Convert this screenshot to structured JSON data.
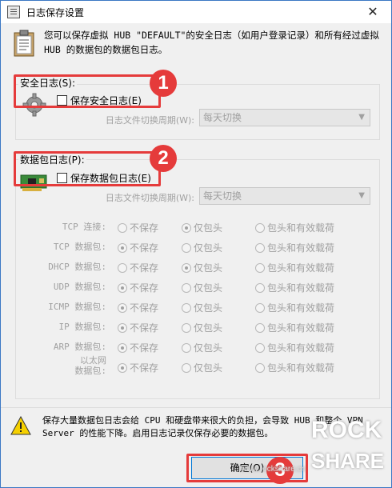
{
  "window": {
    "title": "日志保存设置",
    "close": "✕"
  },
  "intro": "您可以保存虚拟 HUB \"DEFAULT\"的安全日志（如用户登录记录）和所有经过虚拟 HUB 的数据包的数据包日志。",
  "security": {
    "group_label": "安全日志(S):",
    "checkbox_label": "保存安全日志(E)",
    "cycle_label": "日志文件切换周期(W):",
    "cycle_value": "每天切换",
    "badge": "1"
  },
  "packet": {
    "group_label": "数据包日志(P):",
    "checkbox_label": "保存数据包日志(E)",
    "cycle_label": "日志文件切换周期(W):",
    "cycle_value": "每天切换",
    "badge": "2",
    "option_labels": [
      "不保存",
      "仅包头",
      "包头和有效载荷"
    ],
    "rows": [
      {
        "label": "TCP 连接:",
        "selected": 1
      },
      {
        "label": "TCP 数据包:",
        "selected": 0
      },
      {
        "label": "DHCP 数据包:",
        "selected": 1
      },
      {
        "label": "UDP 数据包:",
        "selected": 0
      },
      {
        "label": "ICMP 数据包:",
        "selected": 0
      },
      {
        "label": "IP 数据包:",
        "selected": 0
      },
      {
        "label": "ARP 数据包:",
        "selected": 0
      },
      {
        "label": "以太网\n数据包:",
        "selected": 0
      }
    ]
  },
  "warning": {
    "text": "保存大量数据包日志会给 CPU 和硬盘带来很大的负担，会导致 HUB 和整个 VPN Server 的性能下降。启用日志记录仅保存必要的数据包。"
  },
  "buttons": {
    "ok": "确定(O)",
    "badge": "3"
  },
  "watermark": {
    "line1": "ROCK",
    "line2": "SHARE",
    "url": "www.rockshare.cn"
  },
  "colors": {
    "highlight": "#e53b3b",
    "border": "#3b78c4"
  }
}
